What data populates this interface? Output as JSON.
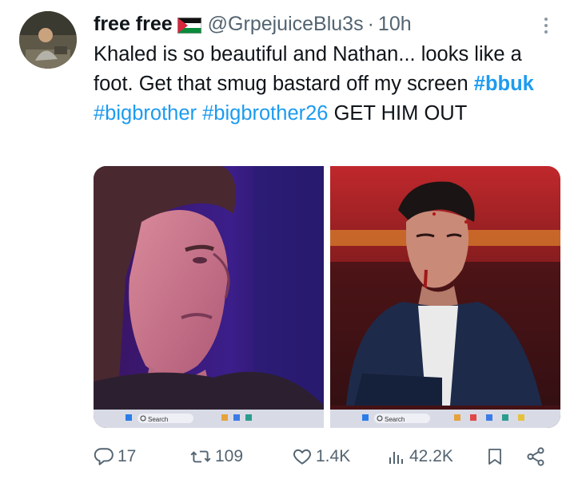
{
  "tweet": {
    "display_name": "free free",
    "handle": "@GrpejuiceBlu3s",
    "separator": "·",
    "time": "10h",
    "text_prefix": "Khaled is so beautiful and Nathan... looks like a foot. Get that smug bastard off my screen ",
    "hashtags": [
      "#bbuk",
      "#bigbrother",
      "#bigbrother26"
    ],
    "text_suffix": " GET HIM OUT"
  },
  "media": {
    "left_taskbar_search": "Search",
    "right_taskbar_search": "Search"
  },
  "actions": {
    "reply_count": "17",
    "repost_count": "109",
    "like_count": "1.4K",
    "view_count": "42.2K"
  },
  "icons": {
    "reply": "reply-icon",
    "repost": "repost-icon",
    "like": "like-icon",
    "views": "views-icon",
    "bookmark": "bookmark-icon",
    "share": "share-icon",
    "more": "more-icon",
    "flag": "palestine-flag-icon"
  },
  "colors": {
    "link": "#1d9bf0",
    "secondary_text": "#536471",
    "primary_text": "#0f1419"
  }
}
